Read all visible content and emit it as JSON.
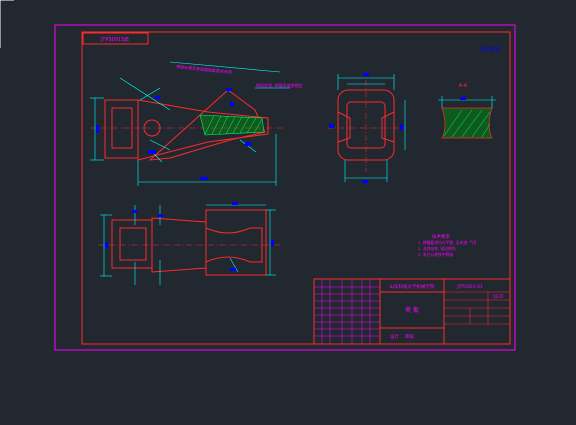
{
  "drawing": {
    "stamp_code": "JTPS001SJE",
    "revision_mark": "技术要求",
    "section_label": "A-A",
    "weld_note": "焊缝处理及表面粗糙度要求参照",
    "detail_note": "焊接处理, 焊缝高度按规定",
    "tech_req": {
      "title": "技术要求",
      "items": [
        "1. 焊缝要求均匀平整, 无夹渣, 气孔",
        "2. 去除毛刺, 锐边倒钝",
        "3. 未注公差按中等级"
      ]
    },
    "title_block": {
      "company": "山东科技大学机械学院",
      "part_name": "夹 板",
      "drawing_no": "JTPS001-01",
      "material": "Q235",
      "designer": "设计",
      "checker": "审核"
    }
  },
  "colors": {
    "background": "#212830",
    "sheet_border": "#ff00ff",
    "frame": "#ff0000",
    "outline": "#ff2a2a",
    "dimension": "#00ffff",
    "text_blue": "#0000ff",
    "text_magenta": "#ff00ff",
    "hatch": "#00ff66",
    "center_line": "#ff0000",
    "white": "#ffffff"
  }
}
